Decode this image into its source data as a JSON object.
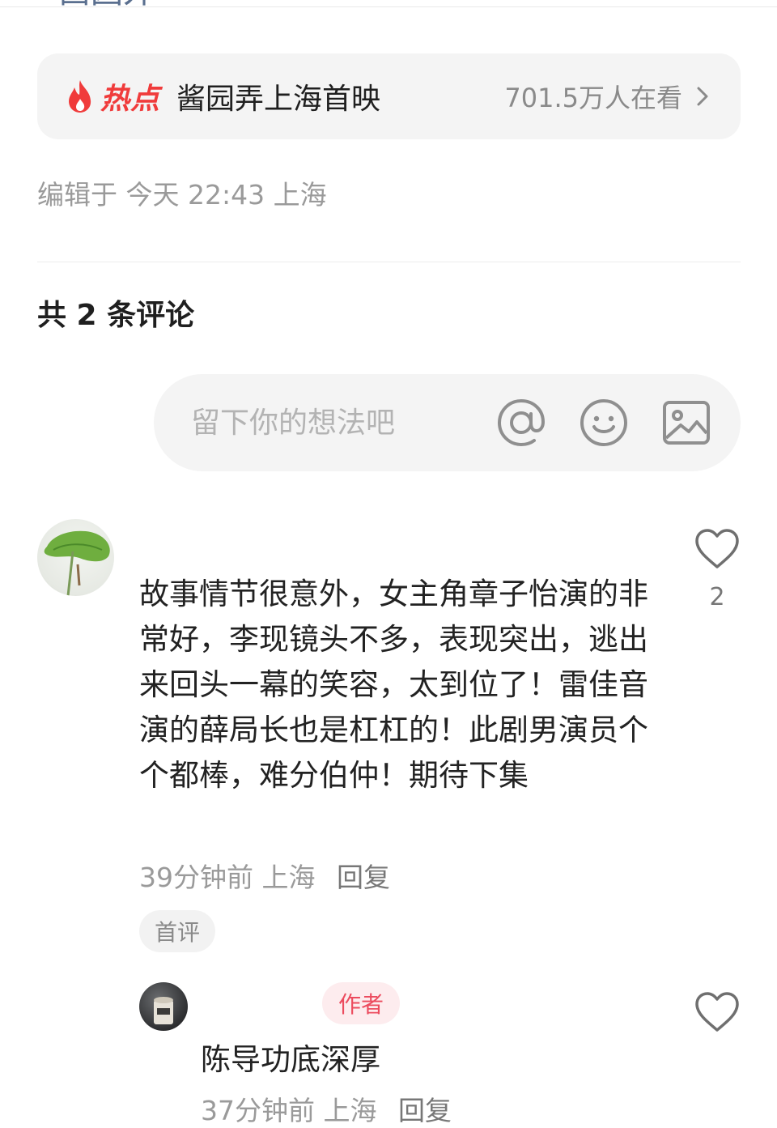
{
  "top_fragment": "西园外",
  "hot_topic": {
    "label": "热点",
    "title": "酱园弄上海首映",
    "watch_count": "701.5万人在看"
  },
  "edit_meta": "编辑于 今天 22:43 上海",
  "comments_header": "共 2 条评论",
  "comment_input": {
    "placeholder": "留下你的想法吧"
  },
  "icons": {
    "hot": "flame-icon",
    "chevron": "chevron-right-icon",
    "mention": "at-icon",
    "emoji": "smile-icon",
    "image": "image-icon",
    "like": "heart-icon"
  },
  "colors": {
    "hot_red": "#f03b3b",
    "author_badge_bg": "#fdecee",
    "author_badge_text": "#ec4b5e"
  },
  "comments": [
    {
      "text": "故事情节很意外，女主角章子怡演的非常好，李现镜头不多，表现突出，逃出来回头一幕的笑容，太到位了！雷佳音演的薛局长也是杠杠的！此剧男演员个个都棒，难分伯仲！期待下集",
      "time": "39分钟前",
      "location": "上海",
      "reply_label": "回复",
      "badge": "首评",
      "likes": "2",
      "replies": [
        {
          "badge": "作者",
          "text": "陈导功底深厚",
          "time": "37分钟前",
          "location": "上海",
          "reply_label": "回复"
        }
      ]
    }
  ]
}
